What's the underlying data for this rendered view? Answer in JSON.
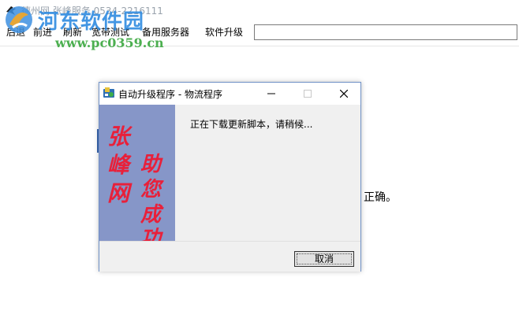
{
  "window": {
    "title": "德州网 张峰服务 0534-2216111"
  },
  "toolbar": {
    "items": [
      "后退",
      "前进",
      "刷新",
      "宽带测试",
      "备用服务器",
      "软件升级"
    ],
    "address_value": ""
  },
  "watermark": {
    "title": "河东软件园",
    "url": "www.pc0359.cn"
  },
  "page": {
    "visible_text": "正确。"
  },
  "dialog": {
    "title": "自动升级程序 - 物流程序",
    "status_text": "正在下载更新脚本，请稍候...",
    "cancel_label": "取消",
    "image_text": [
      "张峰网",
      "助您成功"
    ]
  },
  "colors": {
    "dialog_border": "#6f91c7",
    "image_background": "#8696c8",
    "image_text": "#e8203a",
    "watermark_blue": "#2f8be0",
    "watermark_green": "#4caf50"
  },
  "icons": {
    "app": "bird-icon",
    "dialog": "installer-icon",
    "minimize": "minimize-icon",
    "maximize": "maximize-icon",
    "close": "close-icon"
  }
}
